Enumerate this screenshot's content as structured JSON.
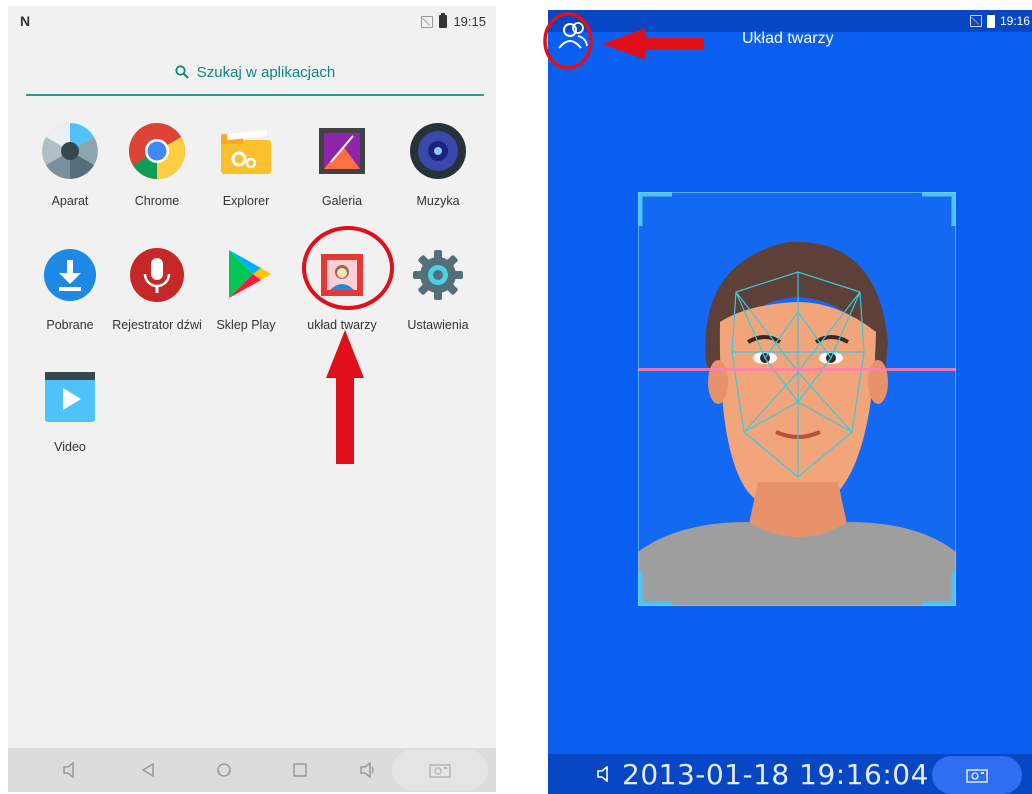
{
  "left_phone": {
    "status": {
      "time": "19:15"
    },
    "search": {
      "placeholder": "Szukaj w aplikacjach"
    },
    "apps": [
      {
        "label": "Aparat",
        "icon": "camera-aperture-icon"
      },
      {
        "label": "Chrome",
        "icon": "chrome-icon"
      },
      {
        "label": "Explorer",
        "icon": "folder-gear-icon"
      },
      {
        "label": "Galeria",
        "icon": "gallery-icon"
      },
      {
        "label": "Muzyka",
        "icon": "speaker-icon"
      },
      {
        "label": "Pobrane",
        "icon": "download-icon"
      },
      {
        "label": "Rejestrator dźwi",
        "icon": "microphone-icon"
      },
      {
        "label": "Sklep Play",
        "icon": "play-store-icon"
      },
      {
        "label": "układ twarzy",
        "icon": "face-layout-app-icon"
      },
      {
        "label": "Ustawienia",
        "icon": "settings-gear-icon"
      },
      {
        "label": "Video",
        "icon": "video-play-icon"
      }
    ]
  },
  "right_phone": {
    "status": {
      "time": "19:16"
    },
    "title": "Układ twarzy",
    "clock_overlay": "2013-01-18 19:16:04"
  },
  "colors": {
    "accent_teal": "#2a9d8f",
    "screen_blue": "#0a5ff0",
    "annotation_red": "#e0101a"
  }
}
